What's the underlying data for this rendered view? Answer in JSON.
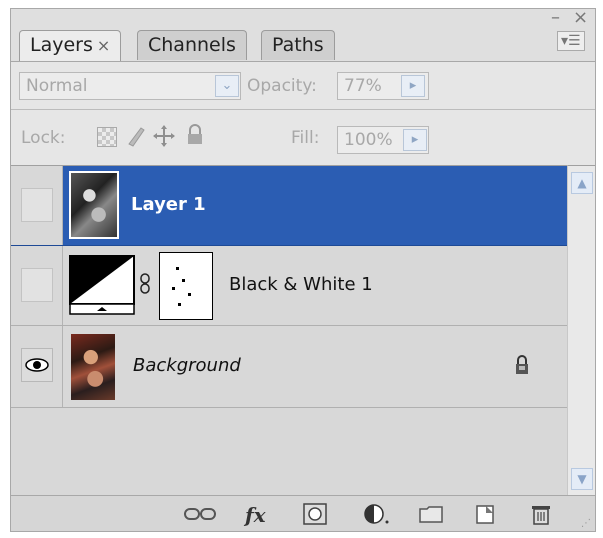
{
  "tabs": [
    {
      "label": "Layers",
      "active": true,
      "close": "×"
    },
    {
      "label": "Channels",
      "active": false
    },
    {
      "label": "Paths",
      "active": false
    }
  ],
  "window": {
    "minimize": "–",
    "close": "×",
    "menu": "▾☰"
  },
  "options": {
    "blend_mode": "Normal",
    "opacity_label": "Opacity:",
    "opacity_value": "77%",
    "lock_label": "Lock:",
    "fill_label": "Fill:",
    "fill_value": "100%"
  },
  "layers": [
    {
      "name": "Layer 1",
      "selected": true,
      "visible": false,
      "bold": true
    },
    {
      "name": "Black & White 1",
      "selected": false,
      "visible": false,
      "adjustment": true
    },
    {
      "name": "Background",
      "selected": false,
      "visible": true,
      "italic": true,
      "locked": true
    }
  ],
  "footer_icons": [
    "link-layers-icon",
    "fx-icon",
    "layer-mask-icon",
    "adjustment-layer-icon",
    "group-folder-icon",
    "new-layer-icon",
    "trash-icon"
  ],
  "fx_label": "fx",
  "colors": {
    "selection": "#2b5db3",
    "panel": "#d7d7d7"
  }
}
